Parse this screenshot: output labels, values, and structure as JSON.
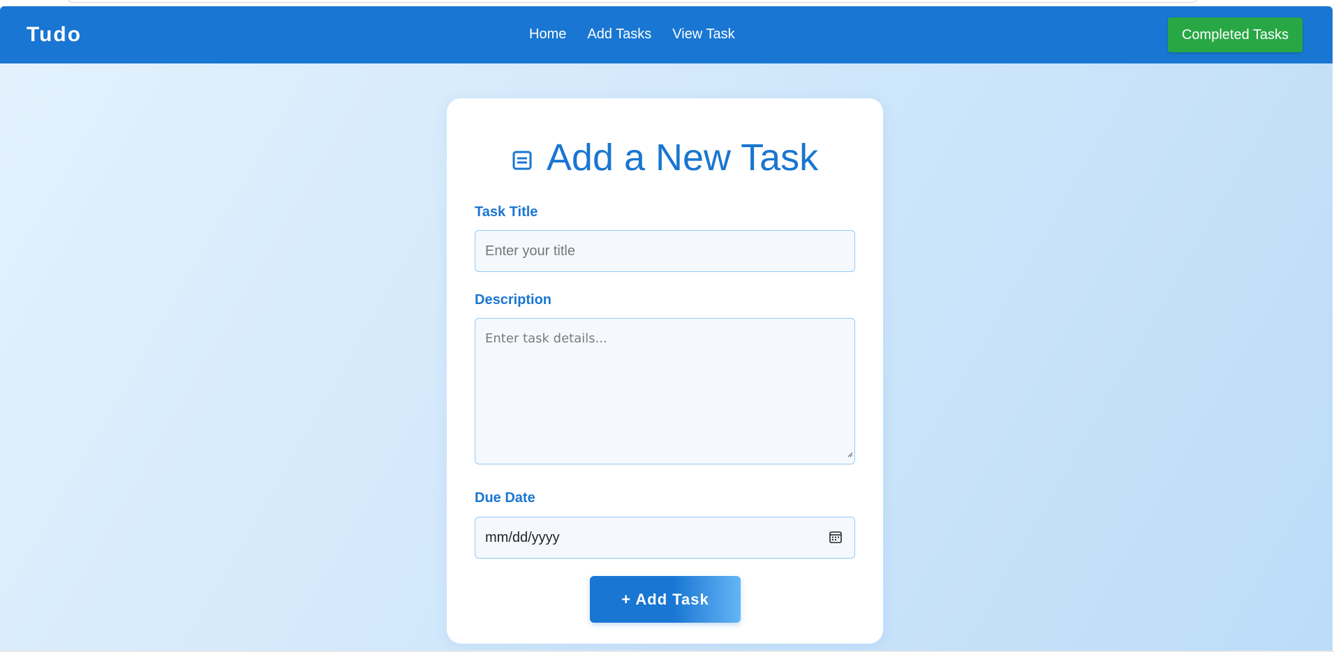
{
  "navbar": {
    "brand": "Tudo",
    "links": [
      "Home",
      "Add Tasks",
      "View Task"
    ],
    "completed_label": "Completed Tasks"
  },
  "form": {
    "heading": "Add a New Task",
    "title_label": "Task Title",
    "title_placeholder": "Enter your title",
    "description_label": "Description",
    "description_placeholder": "Enter task details...",
    "due_label": "Due Date",
    "due_value": "mm/dd/yyyy",
    "submit_label": "+ Add Task"
  },
  "icons": {
    "heading_icon": "document-icon",
    "date_icon": "calendar-icon"
  },
  "colors": {
    "primary": "#1976d2",
    "success": "#28a745",
    "background": "#e3f2fd"
  }
}
